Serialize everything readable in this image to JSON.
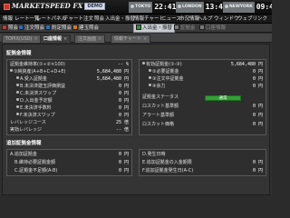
{
  "app": {
    "title": "MARKETSPEED FX",
    "badge": "DEMO"
  },
  "clocks": [
    {
      "city": "TOKYO",
      "time": "22:41"
    },
    {
      "city": "LONDON",
      "time": "13:41"
    },
    {
      "city": "NEWYORK",
      "time": "09:41"
    }
  ],
  "menu": [
    "情報",
    "レート一覧",
    "レートパネル",
    "チャート",
    "注文",
    "照会",
    "入出金・振替",
    "情報チャート",
    "ニュース",
    "市況情報",
    "ヘルプ",
    "ウィンドウ",
    "ウェブリンク"
  ],
  "toolbar": [
    {
      "label": "照会",
      "icon": "red"
    },
    {
      "label": "注文照会",
      "icon": "blue"
    },
    {
      "label": "約定照会",
      "icon": "blue"
    },
    {
      "label": "建玉照会",
      "icon": "orange"
    },
    {
      "label": "入出金・振替",
      "icon": "green",
      "active": true
    },
    {
      "label": "証拠金",
      "icon": "gray",
      "dim": true
    },
    {
      "label": "口座情報",
      "icon": "gray",
      "dim": true
    }
  ],
  "tabs": [
    {
      "label": "TOPIX(USD)"
    },
    {
      "label": "口座情報",
      "active": true
    },
    {
      "label": "注文画面"
    },
    {
      "label": "情報チャート"
    }
  ],
  "account": {
    "section_title": "証拠金情報",
    "left_rows": [
      {
        "label": "証拠金維持率(①÷②×100)",
        "value": "-- %",
        "indent": 0
      },
      {
        "label": "①純資産(A+B+C+D+E)",
        "value": "5,684,480 円",
        "indent": 1
      },
      {
        "label": "A.受入証拠金",
        "value": "5,684,480 円",
        "indent": 2
      },
      {
        "label": "B.未決済建玉評価損益",
        "value": "0 円",
        "indent": 2
      },
      {
        "label": "C.未決済スワップ",
        "value": "0 円",
        "indent": 2
      },
      {
        "label": "D.入出金予定額",
        "value": "0 円",
        "indent": 2
      },
      {
        "label": "E.未決済手数料",
        "value": "0 円",
        "indent": 2
      },
      {
        "label": "F.未決済スワップ",
        "value": "0 円",
        "indent": 2
      },
      {
        "label": "レバレッジコース",
        "value": "25 倍",
        "indent": 0
      },
      {
        "label": "実効レバレッジ",
        "value": "-- 倍",
        "indent": 0
      }
    ],
    "right_rows": [
      {
        "label": "有効証拠金(①-③)",
        "value": "5,684,480 円",
        "indent": 0
      },
      {
        "label": "②必要証拠金",
        "value": "0 円",
        "indent": 1
      },
      {
        "label": "③注文中証拠金",
        "value": "0 円",
        "indent": 1
      },
      {
        "label": "④余力",
        "value": "0 円",
        "indent": 1
      },
      {
        "label": "証拠金ステータス",
        "value": "",
        "indent": 0,
        "status": "通常"
      },
      {
        "label": "ロスカット基準額",
        "value": "0 円",
        "indent": 0
      },
      {
        "label": "アラート基準額",
        "value": "0 円",
        "indent": 0
      },
      {
        "label": "ロスカット価格",
        "value": "0 円",
        "indent": 0
      }
    ]
  },
  "additional": {
    "section_title": "追加証拠金情報",
    "left_rows": [
      {
        "label": "A.追加証拠金",
        "value": "0 円"
      },
      {
        "label": "B.維持必要証拠金額",
        "value": "0 円"
      },
      {
        "label": "C.証拠金不足額(A-B)",
        "value": "0 円"
      }
    ],
    "right_rows": [
      {
        "label": "D.発生日時",
        "value": ""
      },
      {
        "label": "E.追加証拠金の入金期限",
        "value": "0 円"
      },
      {
        "label": "F.追加証拠金発生日(A-C)",
        "value": "0 円"
      }
    ]
  },
  "colors": {
    "status_ok": "#33a037",
    "accent_red": "#c0392b"
  }
}
